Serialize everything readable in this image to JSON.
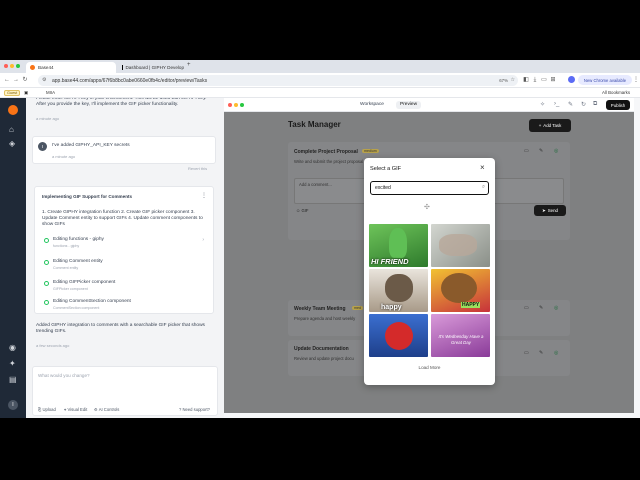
{
  "browser": {
    "tabs": [
      {
        "label": "Base44",
        "active": true
      },
      {
        "label": "Dashboard | GIPHY Develop",
        "active": false
      }
    ],
    "new_tab": "+",
    "url": "app.base44.com/apps/67f6b8bc0abe0660e0fb4c/editor/preview/Tasks",
    "zoom": "67%",
    "update_label": "New Chrome available",
    "bookmarks_label": "All Bookmarks",
    "bookmark_item": "MIIA",
    "guest_label": "Guest"
  },
  "chat": {
    "top_message": "Please enter the API key in your environment. This will be used with the API key. After you provide the key, I'll implement the GIF picker functionality.",
    "top_time": "a minute ago",
    "user_message": "I've added GIPHY_API_KEY secrets",
    "user_avatar": "I",
    "user_time": "a minute ago",
    "revert_label": "Revert this",
    "task_title": "Implementing GIF Support for Comments",
    "task_plan": "1. Create GIPHY integration function 2. Create GIF picker component 3. Update Comment entity to support GIFs 4. Update comment components to show GIFs",
    "steps": [
      {
        "title": "Editing functions - giphy",
        "sub": "functions - giphy"
      },
      {
        "title": "Editing Comment entity",
        "sub": "Comment entity"
      },
      {
        "title": "Editing GIFPicker component",
        "sub": "GIFPicker component"
      },
      {
        "title": "Editing CommentSection component",
        "sub": "CommentSection component"
      }
    ],
    "result_message": "Added GIPHY integration to comments with a searchable GIF picker that shows trending GIFs.",
    "result_time": "a few seconds ago",
    "input_placeholder": "What would you change?",
    "footer": {
      "upload": "Upload",
      "visual_edit": "Visual Edit",
      "ai_controls": "AI Controls",
      "support": "Need support?"
    }
  },
  "preview_toolbar": {
    "tabs": [
      "Workspace",
      "Preview"
    ],
    "active_tab": "Preview",
    "publish_label": "Publish"
  },
  "app": {
    "title": "Task Manager",
    "add_task": "Add Task",
    "tasks": [
      {
        "title": "Complete Project Proposal",
        "badge": "medium",
        "desc": "Write and submit the project proposal"
      },
      {
        "title": "Weekly Team Meeting",
        "badge": "med",
        "desc": "Prepare agenda and host weekly"
      },
      {
        "title": "Update Documentation",
        "badge": "",
        "desc": "Review and update project docu"
      }
    ],
    "comment_placeholder": "Add a comment...",
    "gif_button": "GIF",
    "send_button": "Send"
  },
  "gif_picker": {
    "title": "Select a GIF",
    "close": "×",
    "search_value": "excited",
    "load_more": "Load More",
    "gifs": [
      {
        "name": "gif-hi-friend",
        "caption": "HI FRIEND",
        "colors": [
          "#3b8c3a",
          "#6ec45a"
        ]
      },
      {
        "name": "gif-hands",
        "caption": "",
        "colors": [
          "#b9bdb7",
          "#8a8f88"
        ]
      },
      {
        "name": "gif-pug-happy",
        "caption": "happy",
        "colors": [
          "#d8cfc4",
          "#6b5a48"
        ]
      },
      {
        "name": "gif-happy-cartoon",
        "caption": "HAPPY",
        "colors": [
          "#c7323b",
          "#f1c232"
        ]
      },
      {
        "name": "gif-elmo",
        "caption": "",
        "colors": [
          "#2a5bb8",
          "#d42a2a"
        ]
      },
      {
        "name": "gif-wednesday",
        "caption": "It's Wednesday Have a Great Day",
        "colors": [
          "#c47ac9",
          "#7b2f8a"
        ]
      }
    ]
  },
  "colors": {
    "accent_green": "#22c55e",
    "dark_button": "#111111",
    "chrome_update": "#5b6bf5"
  }
}
